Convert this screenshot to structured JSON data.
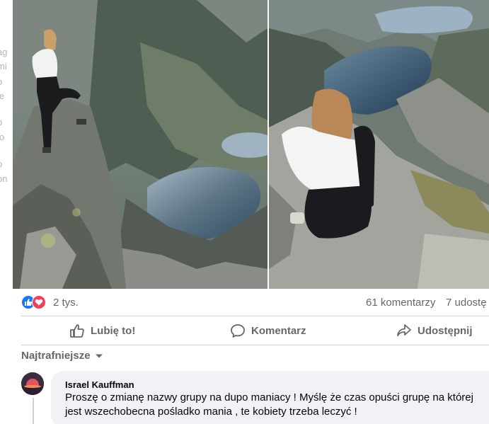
{
  "sidebar_fragments": [
    "ag",
    "mi",
    "p",
    "ie",
    "p",
    "ło",
    "p",
    "on"
  ],
  "post": {
    "reactions": {
      "icons": [
        "like-icon",
        "love-icon"
      ],
      "count": "2 tys."
    },
    "comments_count": "61 komentarzy",
    "shares_count": "7 udostę",
    "actions": {
      "like": "Lubię to!",
      "comment": "Komentarz",
      "share": "Udostępnij"
    },
    "sort_label": "Najtrafniejsze"
  },
  "comment": {
    "author": "Israel Kauffman",
    "text": "Proszę o zmianę nazwy grupy na dupo maniacy ! Myślę że czas opuści grupę na której jest wszechobecna pośladko mania , te kobiety trzeba leczyć !"
  },
  "colors": {
    "like": "#1877f2",
    "love": "#f33e58",
    "muted": "#65676b"
  }
}
